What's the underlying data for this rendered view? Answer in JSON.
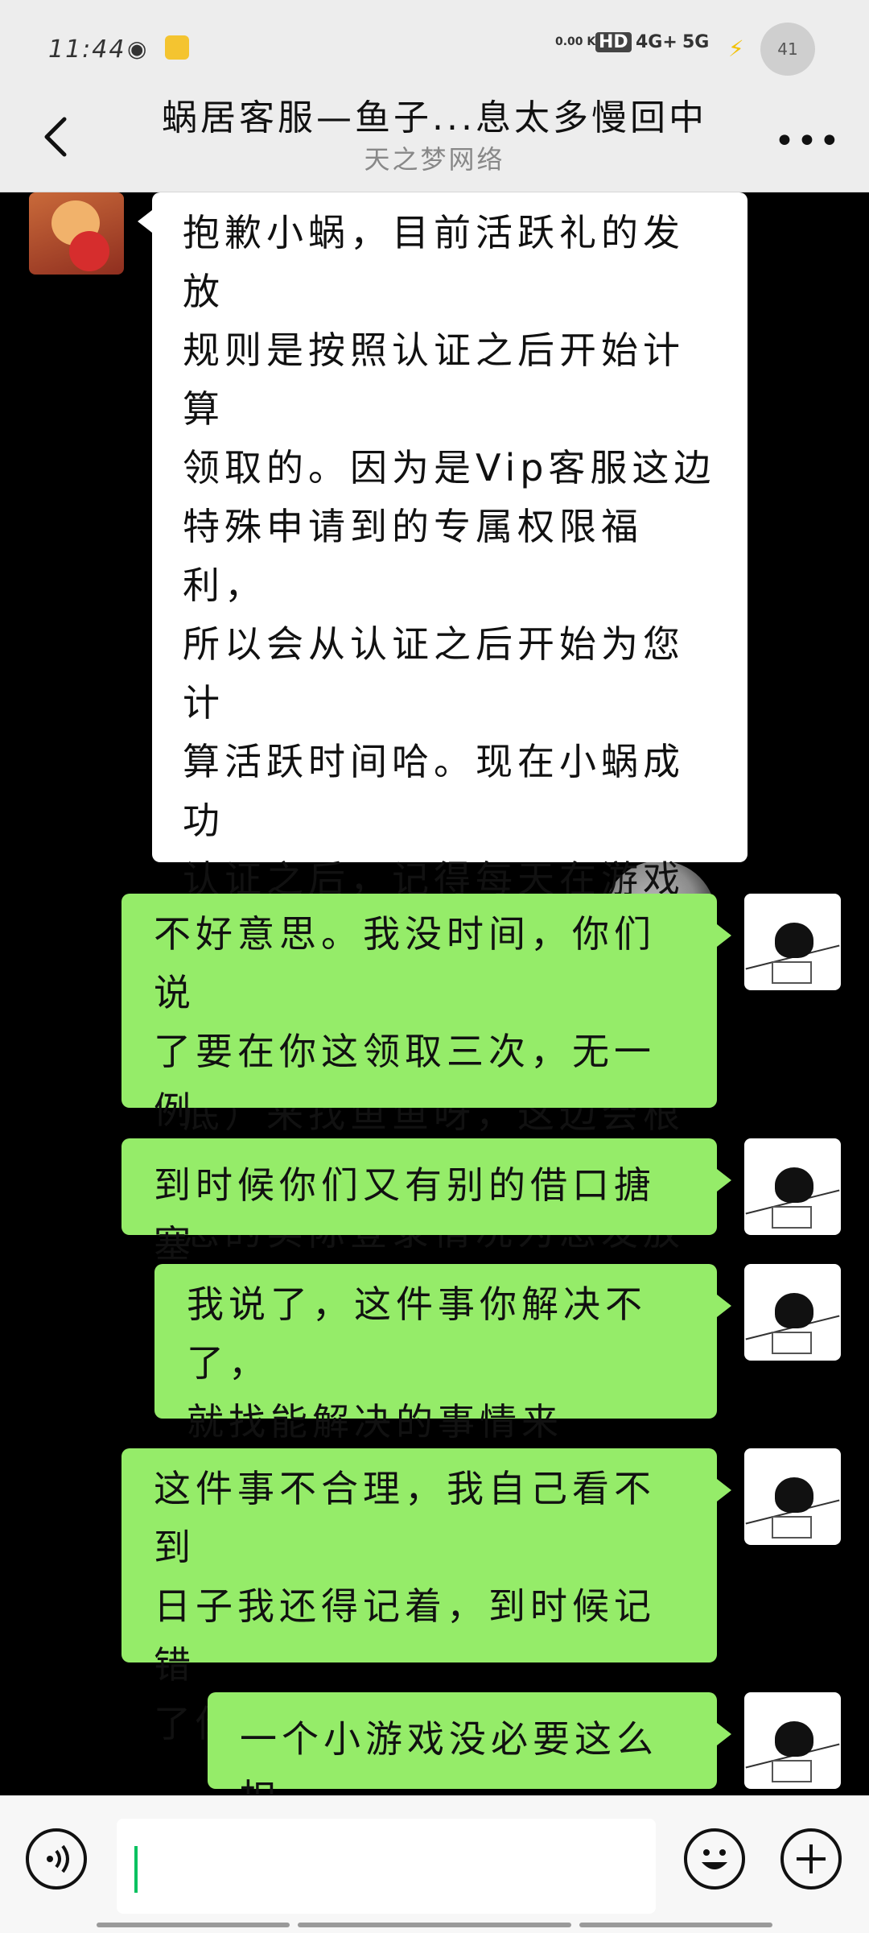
{
  "status_bar": {
    "time": "11:44",
    "net_speed": "0.00 KB/s",
    "hd": "HD",
    "signal1": "4G+",
    "signal2": "5G",
    "battery": "41"
  },
  "header": {
    "title": "蜗居客服—鱼子...息太多慢回中",
    "subtitle": "天之梦网络"
  },
  "messages": [
    {
      "side": "left",
      "text": "抱歉小蜗，目前活跃礼的发放\n规则是按照认证之后开始计算\n领取的。因为是Vip客服这边\n特殊申请到的专属权限福利，\n所以会从认证之后开始为您计\n算活跃时间哈。现在小蜗成功\n认证之后，记得每天在游戏里\n签到，可以固定时间（比如月\n底）来找鱼鱼呀，这边会根据\n您的实际登录情况为您发放活\n跃礼。"
    },
    {
      "side": "right",
      "text": "不好意思。我没时间，你们说\n了要在你这领取三次，无一例\n外是要我自己算着时间"
    },
    {
      "side": "right",
      "text": "到时候你们又有别的借口搪塞"
    },
    {
      "side": "right",
      "text": "我说了，这件事你解决不了，\n就找能解决的事情来"
    },
    {
      "side": "right",
      "text": "这件事不合理，我自己看不到\n日子我还得记着，到时候记错\n了你们又来句过了领取不了"
    },
    {
      "side": "right",
      "text": "一个小游戏没必要这么扣"
    }
  ],
  "icons": {
    "back": "chevron-left-icon",
    "more": "more-dots-icon",
    "voice": "voice-icon",
    "emoji": "emoji-icon",
    "add": "plus-icon"
  },
  "colors": {
    "sent_bubble": "#95ec69",
    "received_bubble": "#ffffff",
    "chat_bg": "#000000",
    "header_bg": "#ededed"
  }
}
